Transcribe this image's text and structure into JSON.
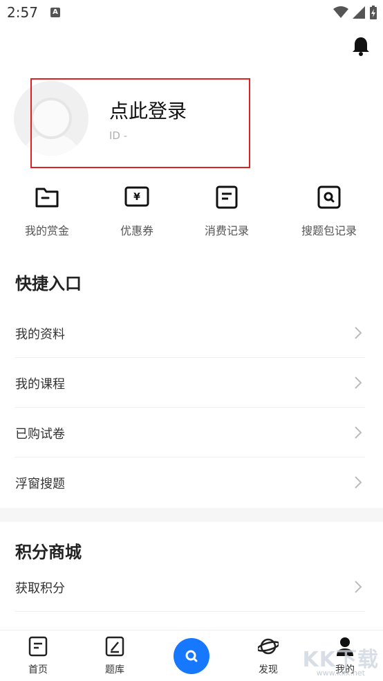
{
  "status_bar": {
    "time": "2:57",
    "notification_letter": "A"
  },
  "profile": {
    "login_title": "点此登录",
    "id_text": "ID -"
  },
  "quick_actions": [
    {
      "label": "我的赏金",
      "icon": "folder-icon"
    },
    {
      "label": "优惠券",
      "icon": "yen-coupon-icon"
    },
    {
      "label": "消费记录",
      "icon": "document-icon"
    },
    {
      "label": "搜题包记录",
      "icon": "search-box-icon"
    }
  ],
  "shortcuts": {
    "title": "快捷入口",
    "items": [
      {
        "label": "我的资料"
      },
      {
        "label": "我的课程"
      },
      {
        "label": "已购试卷"
      },
      {
        "label": "浮窗搜题"
      }
    ]
  },
  "points_mall": {
    "title": "积分商城",
    "items": [
      {
        "label": "获取积分"
      }
    ]
  },
  "tabbar": {
    "items": [
      {
        "label": "首页",
        "icon": "home-doc-icon"
      },
      {
        "label": "题库",
        "icon": "edit-box-icon"
      },
      {
        "label": "",
        "icon": "search-icon"
      },
      {
        "label": "发现",
        "icon": "planet-icon"
      },
      {
        "label": "我的",
        "icon": "person-icon"
      }
    ]
  },
  "watermark": {
    "text": "KK下载",
    "url": "www.kkx.net"
  },
  "colors": {
    "accent": "#1677ff",
    "highlight_border": "#e02020"
  }
}
